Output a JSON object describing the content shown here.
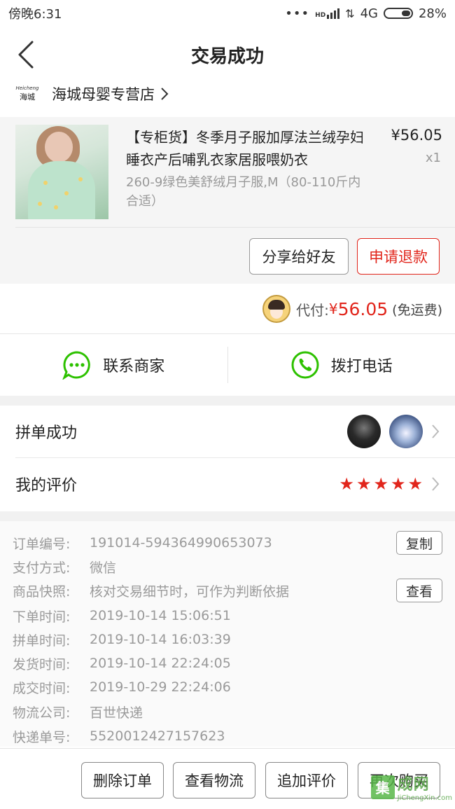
{
  "status_bar": {
    "time": "傍晚6:31",
    "network": "4G",
    "battery": "28%",
    "signal_label": "HD"
  },
  "header": {
    "title": "交易成功"
  },
  "store": {
    "logo_top": "Heicheng",
    "logo_bottom": "海城",
    "name": "海城母婴专营店"
  },
  "product": {
    "title": "【专柜货】冬季月子服加厚法兰绒孕妇睡衣产后哺乳衣家居服喂奶衣",
    "variant": "260-9绿色美舒绒月子服,M（80-110斤内合适）",
    "price": "¥56.05",
    "quantity": "x1",
    "share_label": "分享给好友",
    "refund_label": "申请退款"
  },
  "payment": {
    "label": "代付:",
    "currency": "¥",
    "amount": "56.05",
    "note": "(免运费)"
  },
  "contact": {
    "merchant_label": "联系商家",
    "call_label": "拨打电话"
  },
  "group": {
    "label": "拼单成功"
  },
  "review": {
    "label": "我的评价",
    "rating": 5
  },
  "order_info": {
    "order_no_key": "订单编号:",
    "order_no": "191014-594364990653073",
    "copy_label": "复制",
    "pay_method_key": "支付方式:",
    "pay_method": "微信",
    "snapshot_key": "商品快照:",
    "snapshot": "核对交易细节时，可作为判断依据",
    "view_label": "查看",
    "order_time_key": "下单时间:",
    "order_time": "2019-10-14 15:06:51",
    "group_time_key": "拼单时间:",
    "group_time": "2019-10-14 16:03:39",
    "ship_time_key": "发货时间:",
    "ship_time": "2019-10-14 22:24:05",
    "deal_time_key": "成交时间:",
    "deal_time": "2019-10-29 22:24:06",
    "logistics_key": "物流公司:",
    "logistics": "百世快递",
    "tracking_key": "快递单号:",
    "tracking": "5520012427157623"
  },
  "actions": {
    "delete": "删除订单",
    "logistics": "查看物流",
    "add_review": "追加评价",
    "rebuy": "再次购买"
  },
  "watermark": {
    "box": "集",
    "cn": "成网",
    "en": "JiChengXin.com"
  },
  "colors": {
    "accent_red": "#e1251b",
    "wechat_green": "#2dc100"
  }
}
